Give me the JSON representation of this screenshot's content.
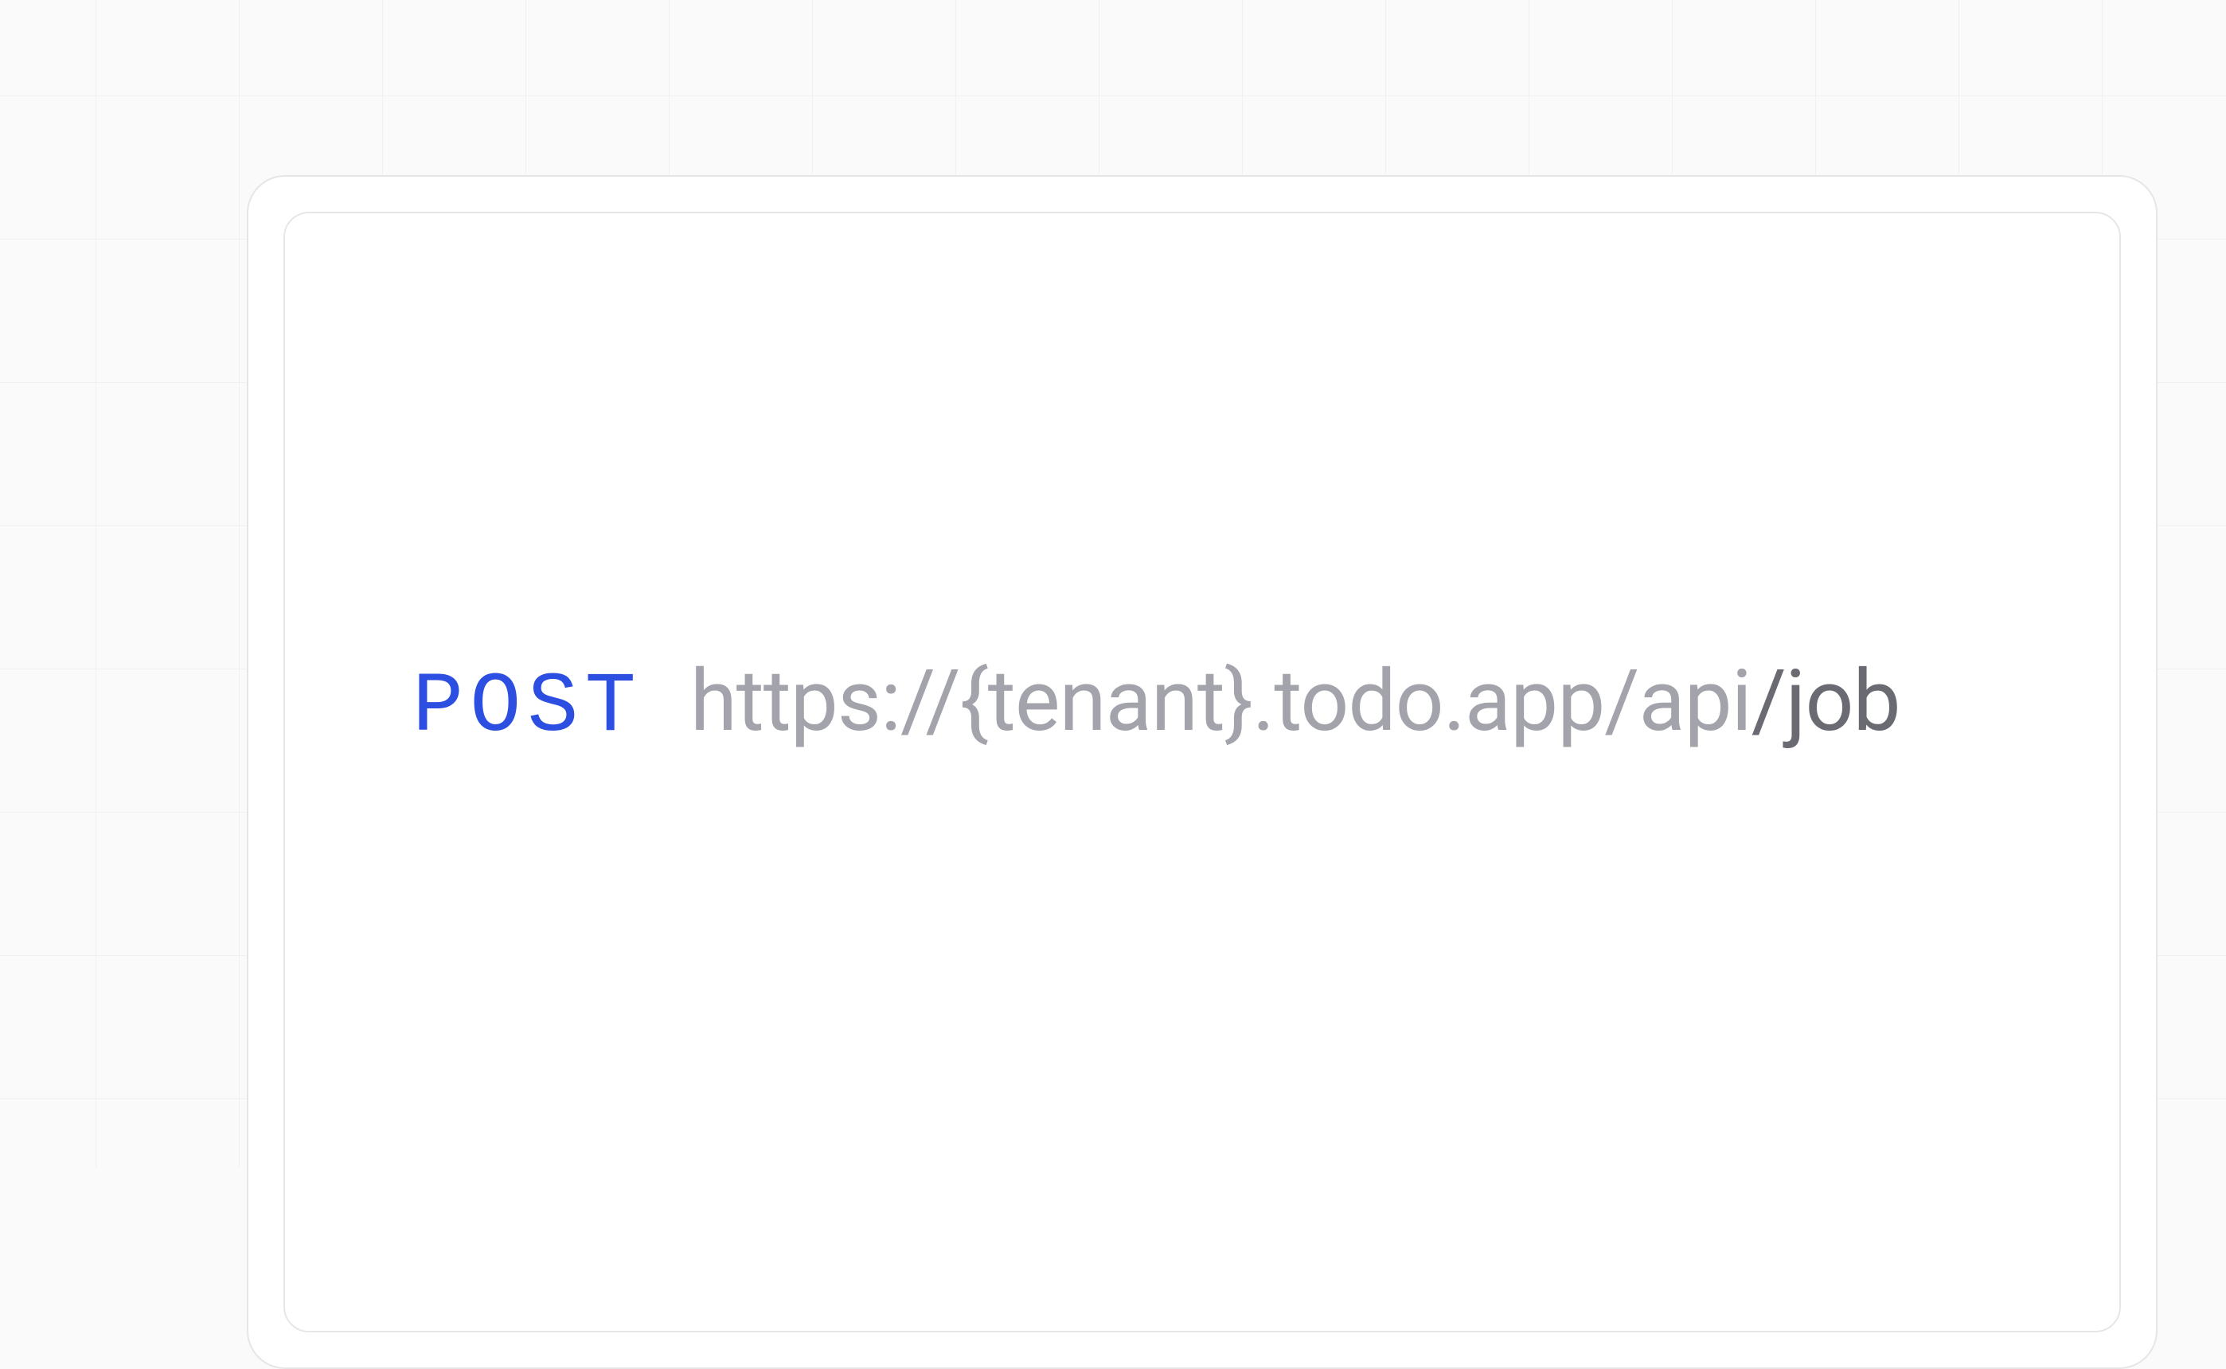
{
  "endpoint": {
    "method": "POST",
    "url_base": "https://{tenant}.todo.app/api",
    "url_path": "/job"
  }
}
